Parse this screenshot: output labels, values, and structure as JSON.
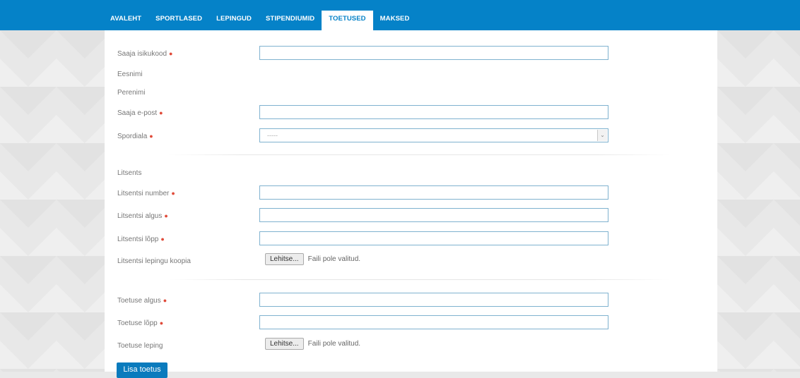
{
  "nav": {
    "items": [
      {
        "label": "AVALEHT"
      },
      {
        "label": "SPORTLASED"
      },
      {
        "label": "LEPINGUD"
      },
      {
        "label": "STIPENDIUMID"
      },
      {
        "label": "TOETUSED",
        "active": true
      },
      {
        "label": "MAKSED"
      }
    ]
  },
  "form": {
    "isikukood": {
      "label": "Saaja isikukood",
      "value": ""
    },
    "eesnimi": {
      "label": "Eesnimi"
    },
    "perenimi": {
      "label": "Perenimi"
    },
    "epost": {
      "label": "Saaja e-post",
      "value": ""
    },
    "spordiala": {
      "label": "Spordiala",
      "selected": "-----"
    },
    "litsents_heading": "Litsents",
    "litsentsi_number": {
      "label": "Litsentsi number",
      "value": ""
    },
    "litsentsi_algus": {
      "label": "Litsentsi algus",
      "value": ""
    },
    "litsentsi_lopp": {
      "label": "Litsentsi lõpp",
      "value": ""
    },
    "litsentsi_koopia": {
      "label": "Litsentsi lepingu koopia",
      "button": "Lehitse...",
      "status": "Faili pole valitud."
    },
    "toetuse_algus": {
      "label": "Toetuse algus",
      "value": ""
    },
    "toetuse_lopp": {
      "label": "Toetuse lõpp",
      "value": ""
    },
    "toetuse_leping": {
      "label": "Toetuse leping",
      "button": "Lehitse...",
      "status": "Faili pole valitud."
    },
    "required_marker": "●",
    "submit_label": "Lisa toetus"
  },
  "colors": {
    "accent": "#0582c8",
    "required": "#e04b3a"
  }
}
